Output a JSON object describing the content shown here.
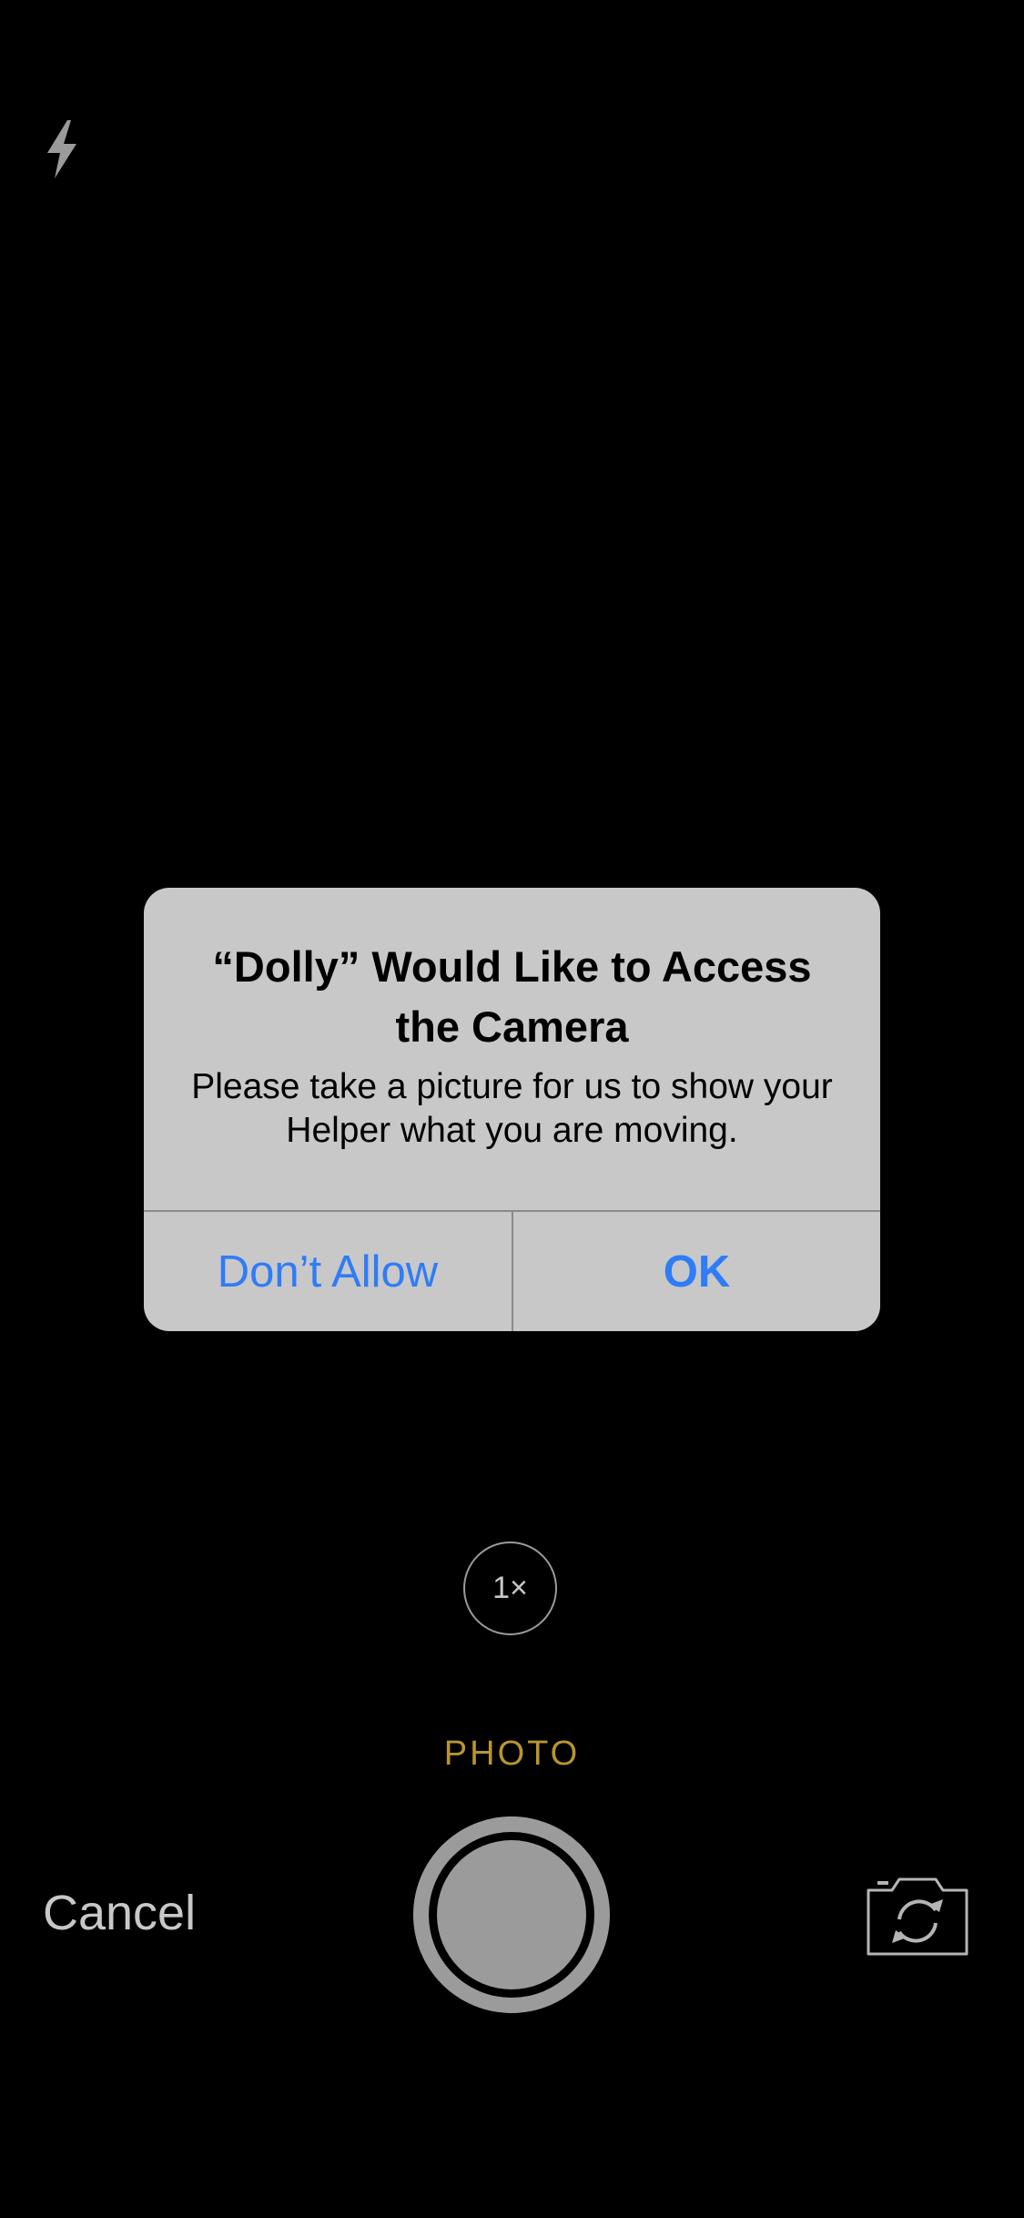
{
  "top_bar": {
    "flash_icon": "flash-icon"
  },
  "alert": {
    "title": "“Dolly” Would Like to Access the Camera",
    "message": "Please take a picture for us to show your Helper what you are moving.",
    "dont_allow_label": "Don’t Allow",
    "ok_label": "OK",
    "button_color": "#2f7cf6"
  },
  "camera": {
    "zoom_label": "1×",
    "mode_label": "PHOTO",
    "mode_color": "#b8962e",
    "cancel_label": "Cancel",
    "shutter_icon": "shutter-button",
    "flip_icon": "camera-flip-icon"
  }
}
